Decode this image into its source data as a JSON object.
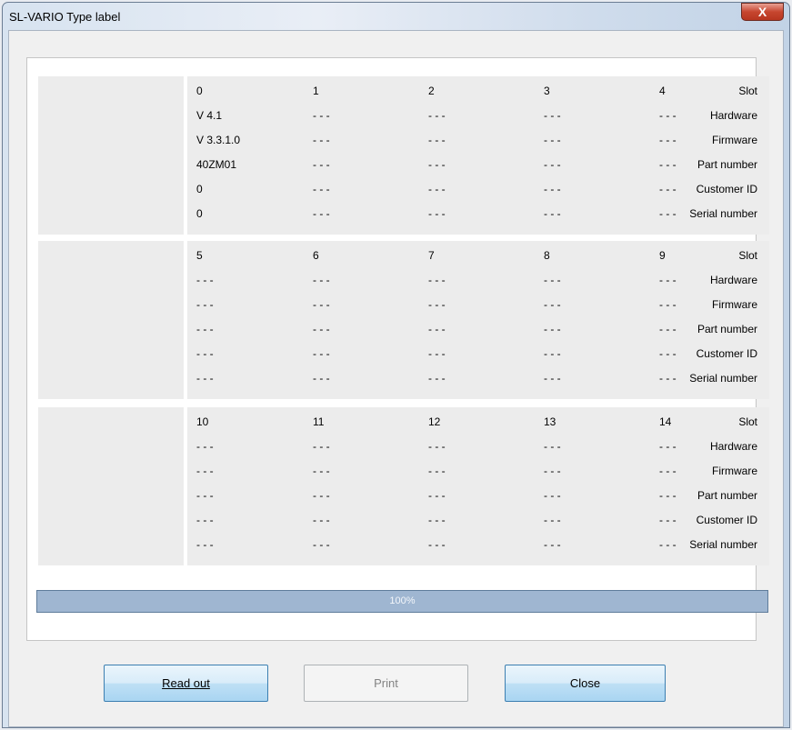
{
  "window": {
    "title": "SL-VARIO Type label",
    "close_glyph": "X"
  },
  "row_labels": [
    "Slot",
    "Hardware",
    "Firmware",
    "Part number",
    "Customer ID",
    "Serial number"
  ],
  "groups": [
    {
      "columns": [
        [
          "0",
          "V 4.1",
          "V 3.3.1.0",
          "40ZM01",
          "0",
          "0"
        ],
        [
          "1",
          "- - -",
          "- - -",
          "- - -",
          "- - -",
          "- - -"
        ],
        [
          "2",
          "- - -",
          "- - -",
          "- - -",
          "- - -",
          "- - -"
        ],
        [
          "3",
          "- - -",
          "- - -",
          "- - -",
          "- - -",
          "- - -"
        ],
        [
          "4",
          "- - -",
          "- - -",
          "- - -",
          "- - -",
          "- - -"
        ]
      ]
    },
    {
      "columns": [
        [
          "5",
          "- - -",
          "- - -",
          "- - -",
          "- - -",
          "- - -"
        ],
        [
          "6",
          "- - -",
          "- - -",
          "- - -",
          "- - -",
          "- - -"
        ],
        [
          "7",
          "- - -",
          "- - -",
          "- - -",
          "- - -",
          "- - -"
        ],
        [
          "8",
          "- - -",
          "- - -",
          "- - -",
          "- - -",
          "- - -"
        ],
        [
          "9",
          "- - -",
          "- - -",
          "- - -",
          "- - -",
          "- - -"
        ]
      ]
    },
    {
      "columns": [
        [
          "10",
          "- - -",
          "- - -",
          "- - -",
          "- - -",
          "- - -"
        ],
        [
          "11",
          "- - -",
          "- - -",
          "- - -",
          "- - -",
          "- - -"
        ],
        [
          "12",
          "- - -",
          "- - -",
          "- - -",
          "- - -",
          "- - -"
        ],
        [
          "13",
          "- - -",
          "- - -",
          "- - -",
          "- - -",
          "- - -"
        ],
        [
          "14",
          "- - -",
          "- - -",
          "- - -",
          "- - -",
          "- - -"
        ]
      ]
    }
  ],
  "progress": {
    "text": "100%",
    "value": 1.0
  },
  "buttons": {
    "readout": "Read out",
    "print": "Print",
    "close": "Close"
  },
  "colors": {
    "progress": "#9fb6d1",
    "button_primary": "#bfe0f5",
    "close_button": "#c7462f"
  }
}
